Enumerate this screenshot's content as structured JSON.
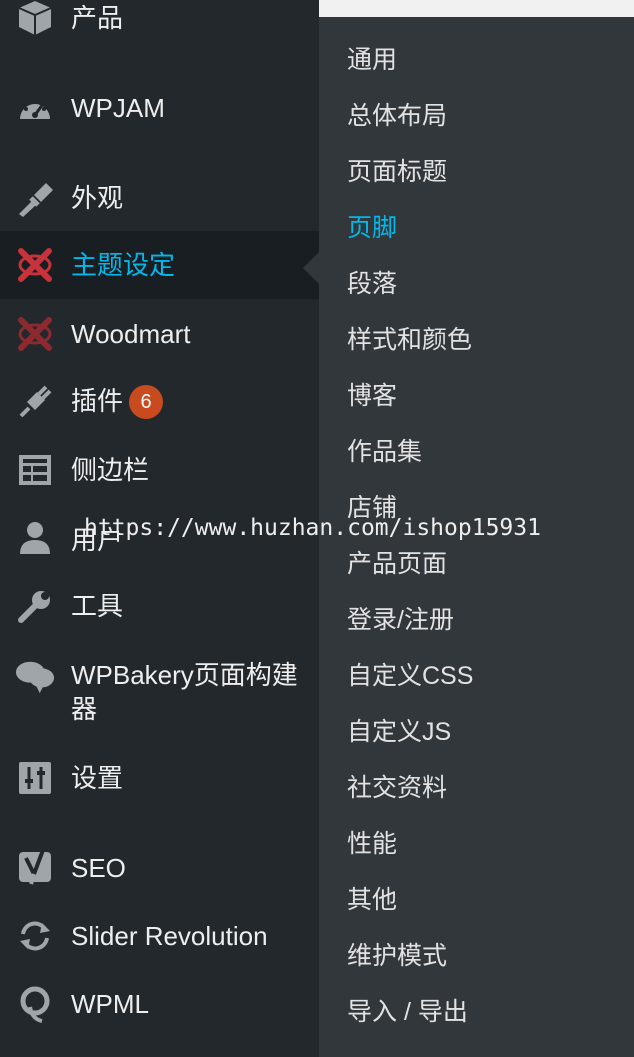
{
  "sidebar": {
    "items": [
      {
        "label": "产品",
        "icon": "archive-icon"
      },
      {
        "label": "WPJAM",
        "icon": "dashboard-gauge-icon"
      },
      {
        "label": "外观",
        "icon": "paint-brush-icon"
      },
      {
        "label": "主题设定",
        "icon": "woodmart-x-icon"
      },
      {
        "label": "Woodmart",
        "icon": "woodmart-x-icon"
      },
      {
        "label": "插件",
        "icon": "plugin-plug-icon",
        "badge": "6"
      },
      {
        "label": "侧边栏",
        "icon": "widgets-layout-icon"
      },
      {
        "label": "用户",
        "icon": "user-icon"
      },
      {
        "label": "工具",
        "icon": "wrench-icon"
      },
      {
        "label": "WPBakery页面构建器",
        "icon": "speech-bubbles-icon"
      },
      {
        "label": "设置",
        "icon": "settings-sliders-icon"
      },
      {
        "label": "SEO",
        "icon": "yoast-y-icon"
      },
      {
        "label": "Slider Revolution",
        "icon": "refresh-arrows-icon"
      },
      {
        "label": "WPML",
        "icon": "wpml-icon"
      }
    ]
  },
  "submenu": {
    "items": [
      {
        "label": "通用"
      },
      {
        "label": "总体布局"
      },
      {
        "label": "页面标题"
      },
      {
        "label": "页脚"
      },
      {
        "label": "段落"
      },
      {
        "label": "样式和颜色"
      },
      {
        "label": "博客"
      },
      {
        "label": "作品集"
      },
      {
        "label": "店铺"
      },
      {
        "label": "产品页面"
      },
      {
        "label": "登录/注册"
      },
      {
        "label": "自定义CSS"
      },
      {
        "label": "自定义JS"
      },
      {
        "label": "社交资料"
      },
      {
        "label": "性能"
      },
      {
        "label": "其他"
      },
      {
        "label": "维护模式"
      },
      {
        "label": "导入 / 导出"
      }
    ]
  },
  "watermark": "https://www.huzhan.com/ishop15931",
  "colors": {
    "sidebar_bg": "#23282d",
    "submenu_bg": "#32373c",
    "current_bg": "#191e23",
    "accent": "#00b9eb",
    "badge": "#ca4a1f",
    "woodmart_red": "#b3262e"
  }
}
